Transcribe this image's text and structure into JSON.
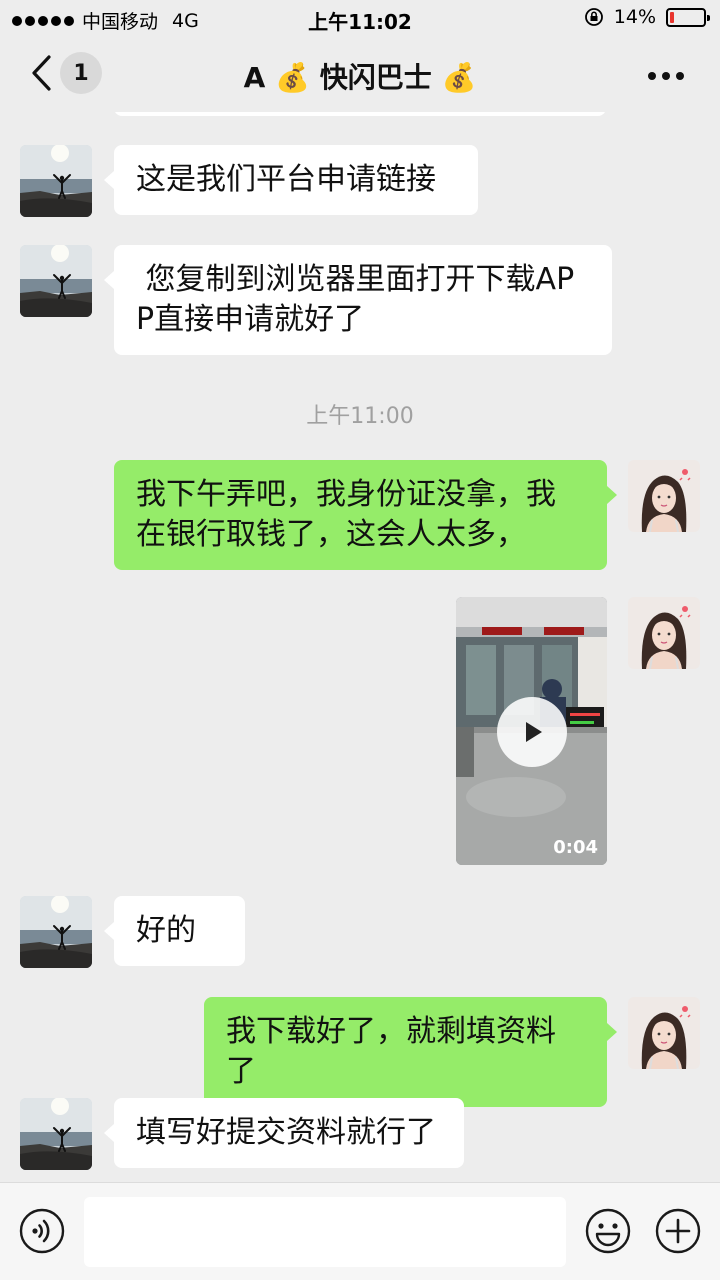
{
  "status_bar": {
    "carrier": "中国移动",
    "network": "4G",
    "time": "上午11:02",
    "battery": "14%",
    "battery_level": 0.14,
    "battery_color": "#e8352e"
  },
  "nav": {
    "unread_count": "1",
    "title": "A 💰 快闪巴士 💰"
  },
  "messages": [
    {
      "side": "left",
      "text": "这是我们平台申请链接"
    },
    {
      "side": "left",
      "text": " 您复制到浏览器里面打开下载APP直接申请就好了"
    },
    {
      "type": "time",
      "text": "上午11:00"
    },
    {
      "side": "right",
      "text": "我下午弄吧，我身份证没拿，我在银行取钱了，这会人太多，"
    },
    {
      "side": "right",
      "type": "video",
      "duration": "0:04"
    },
    {
      "side": "left",
      "text": "好的"
    },
    {
      "side": "right",
      "text": "我下载好了，就剩填资料了"
    },
    {
      "side": "left",
      "text": "填写好提交资料就行了"
    }
  ],
  "colors": {
    "outgoing_bubble": "#95ec69",
    "incoming_bubble": "#ffffff",
    "chat_background": "#ededed"
  },
  "icons": {
    "back": "chevron-left-icon",
    "more": "more-dots-icon",
    "voice": "voice-icon",
    "emoji": "emoji-icon",
    "plus": "plus-icon",
    "play": "play-icon"
  },
  "input": {
    "value": ""
  }
}
